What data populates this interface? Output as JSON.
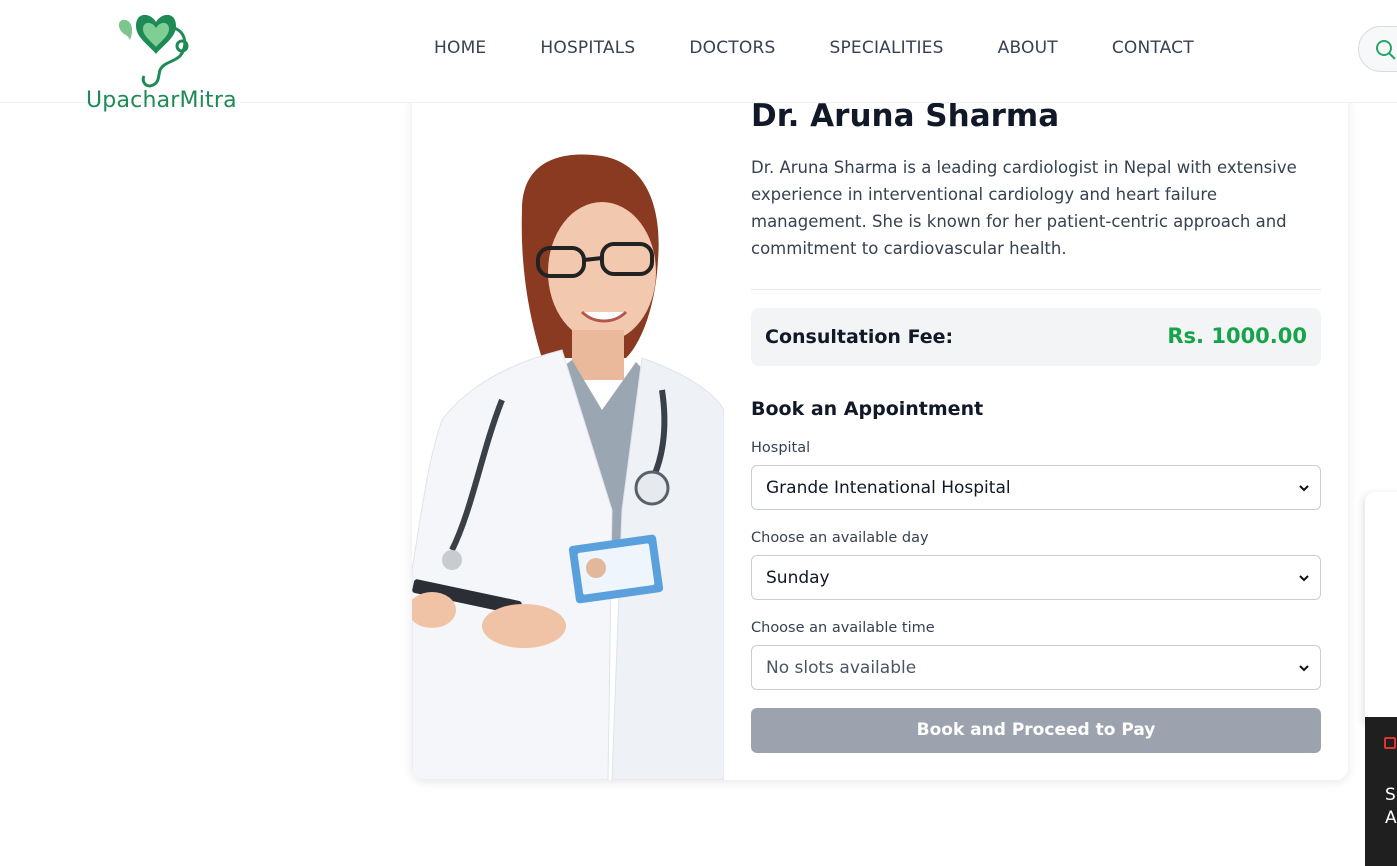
{
  "brand": {
    "name": "UpacharMitra",
    "color": "#1e8a55"
  },
  "nav": {
    "items": [
      "HOME",
      "HOSPITALS",
      "DOCTORS",
      "SPECIALITIES",
      "ABOUT",
      "CONTACT"
    ]
  },
  "search": {
    "icon": "search-icon"
  },
  "doctor": {
    "name": "Dr. Aruna Sharma",
    "bio": "Dr. Aruna Sharma is a leading cardiologist in Nepal with extensive experience in interventional cardiology and heart failure management. She is known for her patient-centric approach and commitment to cardiovascular health.",
    "photo": "doctor-portrait"
  },
  "fee": {
    "label": "Consultation Fee:",
    "value": "Rs. 1000.00",
    "color": "#16a34a"
  },
  "booking": {
    "title": "Book an Appointment",
    "hospital_label": "Hospital",
    "hospital_value": "Grande Intenational Hospital",
    "day_label": "Choose an available day",
    "day_value": "Sunday",
    "time_label": "Choose an available time",
    "time_value": "No slots available",
    "submit_label": "Book and Proceed to Pay",
    "submit_color": "#9ca3af"
  },
  "side_widget": {
    "line1": "S",
    "line2": "A"
  }
}
